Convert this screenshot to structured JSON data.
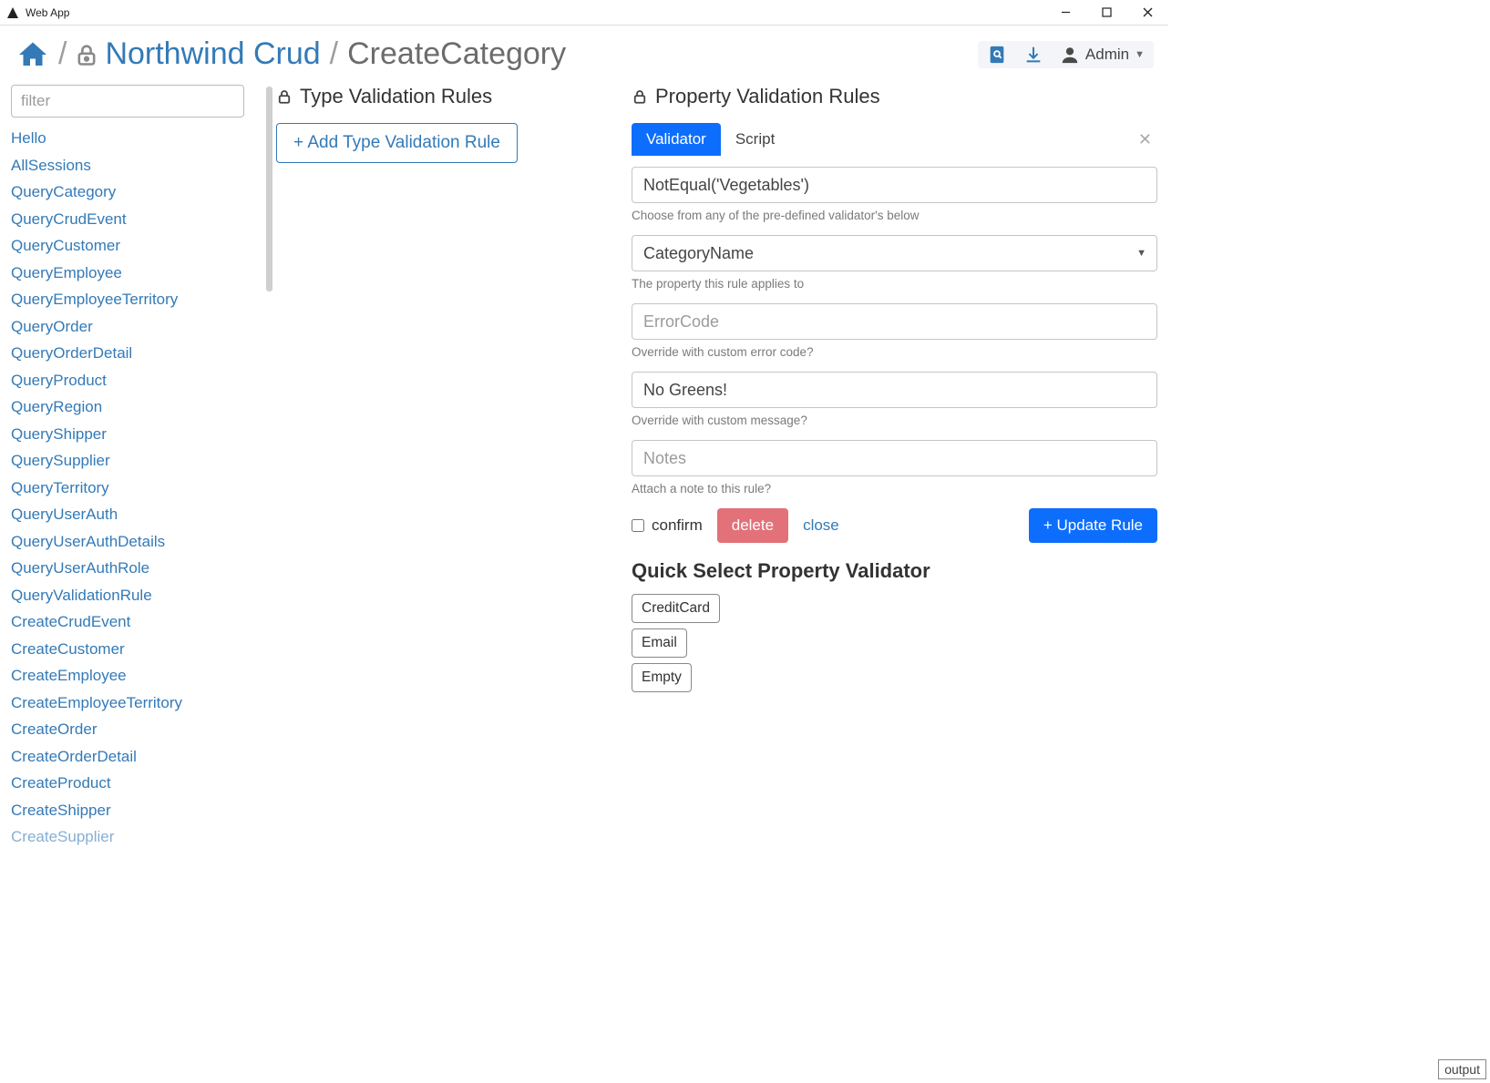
{
  "window": {
    "title": "Web App"
  },
  "breadcrumb": {
    "link": "Northwind Crud",
    "current": "CreateCategory"
  },
  "toolbar": {
    "admin_label": "Admin"
  },
  "sidebar": {
    "filter_placeholder": "filter",
    "items": [
      "Hello",
      "AllSessions",
      "QueryCategory",
      "QueryCrudEvent",
      "QueryCustomer",
      "QueryEmployee",
      "QueryEmployeeTerritory",
      "QueryOrder",
      "QueryOrderDetail",
      "QueryProduct",
      "QueryRegion",
      "QueryShipper",
      "QuerySupplier",
      "QueryTerritory",
      "QueryUserAuth",
      "QueryUserAuthDetails",
      "QueryUserAuthRole",
      "QueryValidationRule",
      "CreateCrudEvent",
      "CreateCustomer",
      "CreateEmployee",
      "CreateEmployeeTerritory",
      "CreateOrder",
      "CreateOrderDetail",
      "CreateProduct",
      "CreateShipper",
      "CreateSupplier"
    ]
  },
  "type_rules": {
    "title": "Type Validation Rules",
    "add_label": "+ Add Type Validation Rule"
  },
  "prop_rules": {
    "title": "Property Validation Rules",
    "tab_validator": "Validator",
    "tab_script": "Script",
    "validator_value": "NotEqual('Vegetables')",
    "validator_help": "Choose from any of the pre-defined validator's below",
    "property_select": "CategoryName",
    "property_help": "The property this rule applies to",
    "errorcode_placeholder": "ErrorCode",
    "errorcode_help": "Override with custom error code?",
    "message_value": "No Greens!",
    "message_help": "Override with custom message?",
    "notes_placeholder": "Notes",
    "notes_help": "Attach a note to this rule?",
    "confirm_label": "confirm",
    "delete_label": "delete",
    "close_label": "close",
    "update_label": "+ Update Rule"
  },
  "quick": {
    "title": "Quick Select Property Validator",
    "items": [
      "CreditCard",
      "Email",
      "Empty"
    ]
  },
  "output_label": "output"
}
